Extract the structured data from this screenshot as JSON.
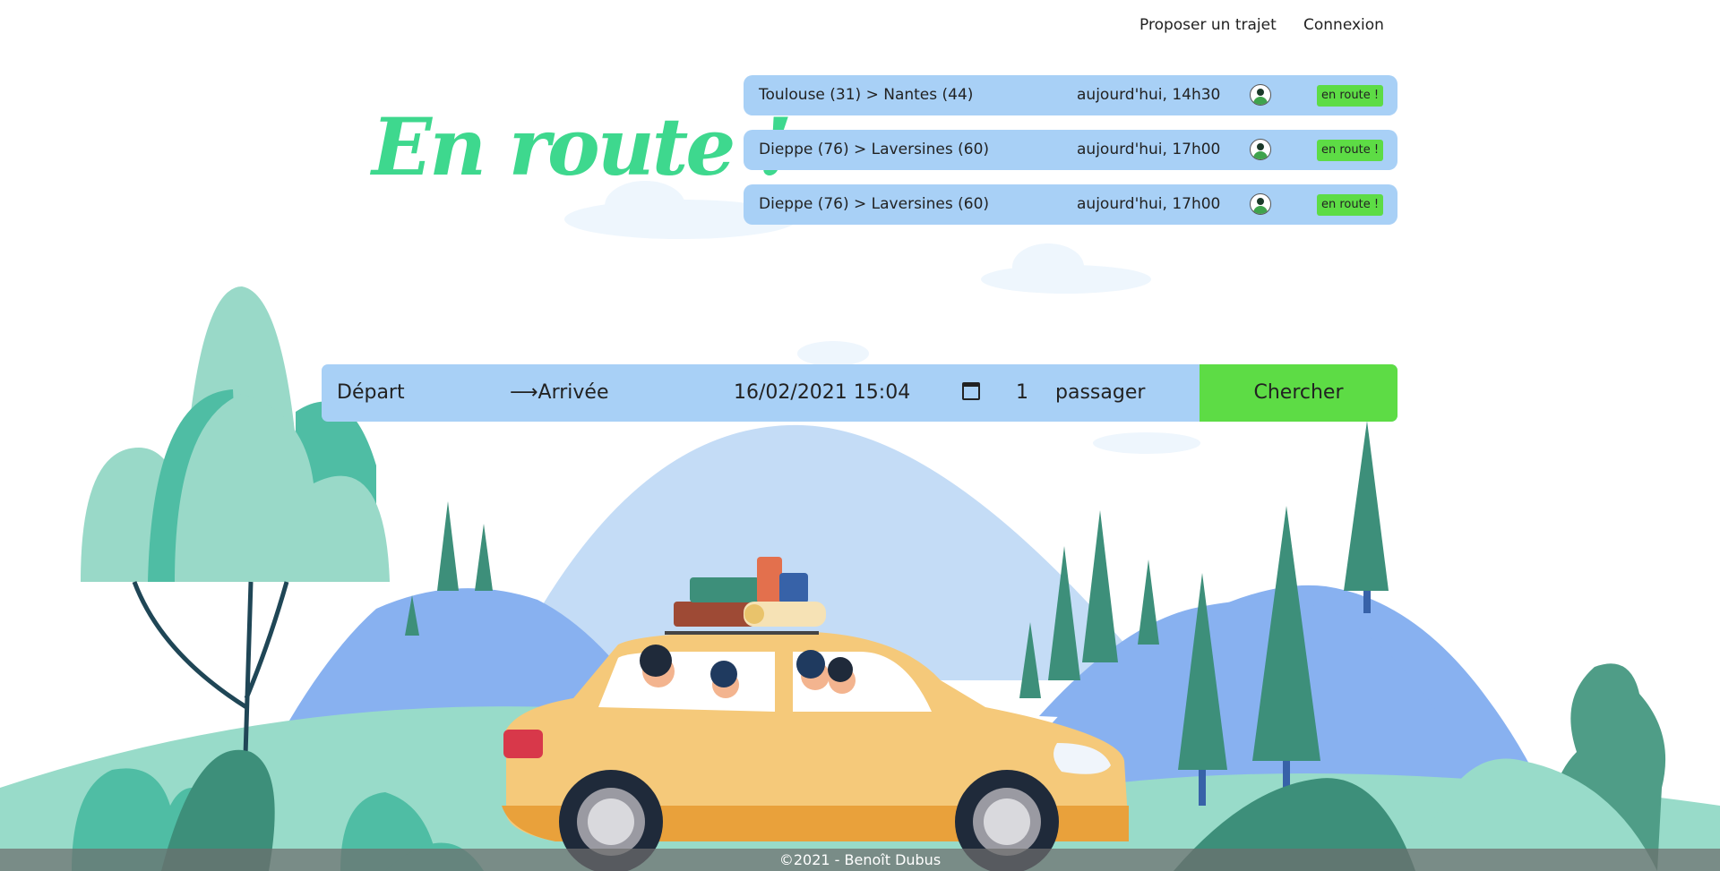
{
  "nav": {
    "propose": "Proposer un trajet",
    "login": "Connexion"
  },
  "logo": "En route !",
  "trips": [
    {
      "route": "Toulouse (31) > Nantes (44)",
      "time": "aujourd'hui, 14h30",
      "status": "en route !"
    },
    {
      "route": "Dieppe (76) > Laversines (60)",
      "time": "aujourd'hui, 17h00",
      "status": "en route !"
    },
    {
      "route": "Dieppe (76) > Laversines (60)",
      "time": "aujourd'hui, 17h00",
      "status": "en route !"
    }
  ],
  "search": {
    "departure_placeholder": "Départ",
    "arrival_placeholder": "⟶Arrivée",
    "date_value": "16/02/2021 15:04",
    "passengers_value": "1",
    "passengers_label": "passager",
    "button_label": "Chercher"
  },
  "footer": "©2021 - Benoît Dubus",
  "colors": {
    "accent_green": "#3ed88e",
    "button_green": "#5ddc45",
    "card_blue": "#a8d0f6"
  }
}
